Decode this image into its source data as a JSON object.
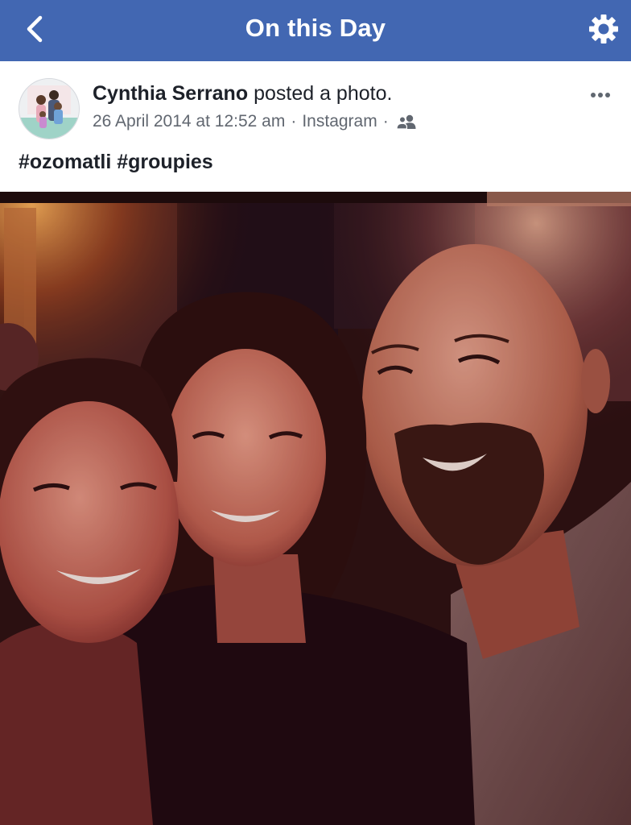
{
  "nav": {
    "title": "On this Day",
    "back_icon": "chevron-left-icon",
    "settings_icon": "gear-icon",
    "background": "#4267b2"
  },
  "post": {
    "author": "Cynthia Serrano",
    "action": "posted a photo.",
    "date": "26 April 2014 at 12:52 am",
    "separator": "·",
    "source": "Instagram",
    "audience_icon": "friends-icon",
    "more_icon": "more-horizontal-icon",
    "caption": "#ozomatli #groupies"
  }
}
